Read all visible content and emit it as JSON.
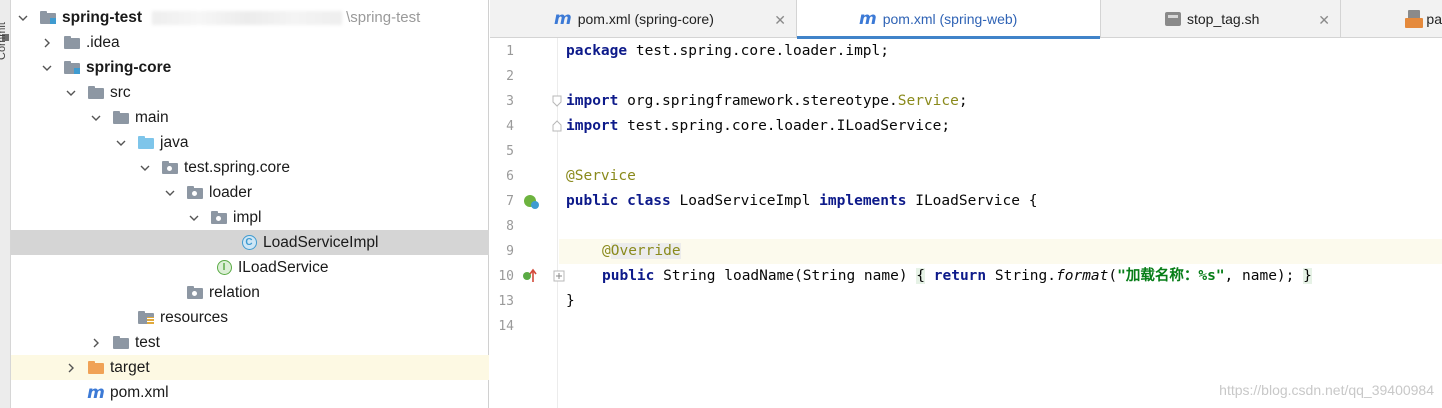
{
  "sidebar": {
    "label": "Commit"
  },
  "tree": {
    "root": {
      "name": "spring-test",
      "path": "\\spring-test"
    },
    "idea": {
      "name": ".idea"
    },
    "module": {
      "name": "spring-core"
    },
    "src": {
      "name": "src"
    },
    "main": {
      "name": "main"
    },
    "java": {
      "name": "java"
    },
    "pkg": {
      "name": "test.spring.core"
    },
    "loader": {
      "name": "loader"
    },
    "impl": {
      "name": "impl"
    },
    "loadServiceImpl": {
      "name": "LoadServiceImpl"
    },
    "iLoadService": {
      "name": "ILoadService"
    },
    "relation": {
      "name": "relation"
    },
    "resources": {
      "name": "resources"
    },
    "test": {
      "name": "test"
    },
    "target": {
      "name": "target"
    },
    "pom": {
      "name": "pom.xml"
    }
  },
  "tabs": [
    {
      "label": "pom.xml (spring-core)"
    },
    {
      "label": "pom.xml (spring-web)"
    },
    {
      "label": "stop_tag.sh"
    },
    {
      "label": "pa"
    }
  ],
  "editor": {
    "line_numbers": [
      "1",
      "2",
      "3",
      "4",
      "5",
      "6",
      "7",
      "8",
      "9",
      "10",
      "13",
      "14"
    ],
    "line1": {
      "kw": "package",
      "rest": " test.spring.core.loader.impl;"
    },
    "line3": {
      "kw": "import",
      "rest": " org.springframework.stereotype.",
      "ann": "Service",
      "end": ";"
    },
    "line4": {
      "kw": "import",
      "rest": " test.spring.core.loader.ILoadService;"
    },
    "line6": {
      "ann": "@Service"
    },
    "line7": {
      "kw1": "public class",
      "name": " LoadServiceImpl ",
      "kw2": "implements",
      "rest": " ILoadService {"
    },
    "line9": {
      "ann_at": "@",
      "ann_name": "Override"
    },
    "line10": {
      "kw1": "public",
      "sig": " String loadName(String name) ",
      "open": "{",
      "sp": " ",
      "kw2": "return",
      "call": " String.",
      "fn": "format",
      "paren": "(",
      "str": "\"加载名称：%s\"",
      "args": ", name); ",
      "close": "}"
    },
    "line13": {
      "text": "}"
    }
  },
  "watermark": "https://blog.csdn.net/qq_39400984",
  "colors": {
    "folder": "#8d97a3",
    "source_folder": "#7ec5ea",
    "excluded_folder": "#f0a256",
    "class": "#3f9bd0",
    "interface": "#5aab45",
    "accent": "#4083c9"
  }
}
